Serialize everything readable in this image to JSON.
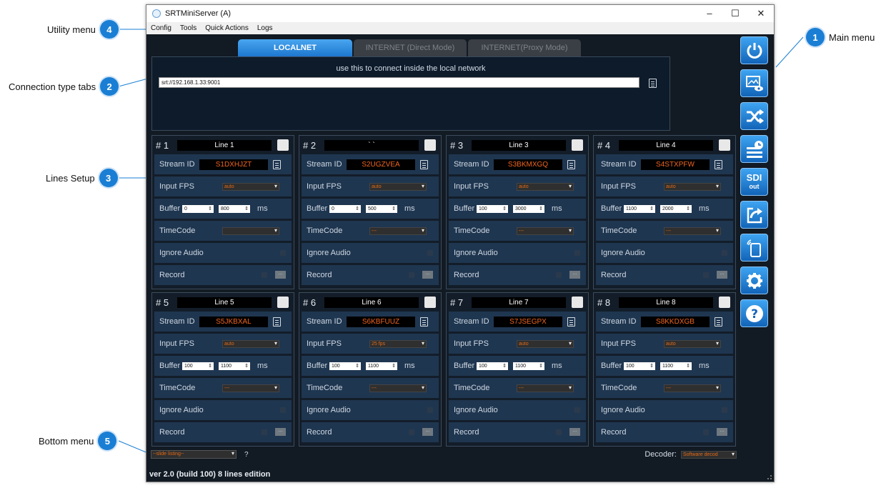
{
  "window": {
    "title": "SRTMiniServer (A)",
    "controls": [
      "–",
      "☐",
      "✕"
    ]
  },
  "menubar": [
    "Config",
    "Tools",
    "Quick Actions",
    "Logs"
  ],
  "tabs": [
    "LOCALNET",
    "INTERNET (Direct Mode)",
    "INTERNET(Proxy Mode)"
  ],
  "tab_panel": {
    "hint": "use this to connect inside the local network",
    "url": "srt://192.168.1.33:9001"
  },
  "labels": {
    "stream_id": "Stream ID",
    "input_fps": "Input FPS",
    "buffer": "Buffer",
    "ms": "ms",
    "timecode": "TimeCode",
    "ignore_audio": "Ignore Audio",
    "record": "Record",
    "record_btn": "..."
  },
  "lines": [
    {
      "num": "# 1",
      "name": "Line 1",
      "stream_id": "S1DXHJZT",
      "fps": "auto",
      "buf_min": "0",
      "buf_max": "800",
      "timecode": ""
    },
    {
      "num": "# 2",
      "name": "` `",
      "stream_id": "S2UGZVEA",
      "fps": "auto",
      "buf_min": "0",
      "buf_max": "500",
      "timecode": "---"
    },
    {
      "num": "# 3",
      "name": "Line 3",
      "stream_id": "S3BKMXGQ",
      "fps": "auto",
      "buf_min": "100",
      "buf_max": "3000",
      "timecode": "---"
    },
    {
      "num": "# 4",
      "name": "Line 4",
      "stream_id": "S4STXPFW",
      "fps": "auto",
      "buf_min": "1100",
      "buf_max": "2000",
      "timecode": "---"
    },
    {
      "num": "# 5",
      "name": "Line 5",
      "stream_id": "S5JKBXAL",
      "fps": "auto",
      "buf_min": "100",
      "buf_max": "1100",
      "timecode": "---"
    },
    {
      "num": "# 6",
      "name": "Line 6",
      "stream_id": "S6KBFUUZ",
      "fps": "25 fps",
      "buf_min": "100",
      "buf_max": "1100",
      "timecode": "---"
    },
    {
      "num": "# 7",
      "name": "Line 7",
      "stream_id": "S7JSEGPX",
      "fps": "auto",
      "buf_min": "100",
      "buf_max": "1100",
      "timecode": "---"
    },
    {
      "num": "# 8",
      "name": "Line 8",
      "stream_id": "S8KKDXGB",
      "fps": "auto",
      "buf_min": "100",
      "buf_max": "1100",
      "timecode": "---"
    }
  ],
  "side_menu": [
    {
      "icon": "power-icon"
    },
    {
      "icon": "preview-icon"
    },
    {
      "icon": "shuffle-icon"
    },
    {
      "icon": "schedule-icon"
    },
    {
      "icon": "sdi-out-icon",
      "text": "SDI",
      "sub": "out"
    },
    {
      "icon": "share-icon"
    },
    {
      "icon": "mobile-icon"
    },
    {
      "icon": "settings-icon"
    },
    {
      "icon": "help-icon"
    }
  ],
  "bottom": {
    "slide_listing": "--slide listing--",
    "help": "?",
    "decoder_label": "Decoder:",
    "decoder_value": "Software decod",
    "version": "ver 2.0 (build 100)   8 lines edition"
  },
  "callouts": [
    {
      "num": "1",
      "label": "Main menu"
    },
    {
      "num": "2",
      "label": "Connection type tabs"
    },
    {
      "num": "3",
      "label": "Lines Setup"
    },
    {
      "num": "4",
      "label": "Utility menu"
    },
    {
      "num": "5",
      "label": "Bottom menu"
    }
  ],
  "colors": {
    "accent": "#1a7fd4",
    "stream_id": "#f0641e",
    "panel_bg": "#1f3650"
  }
}
